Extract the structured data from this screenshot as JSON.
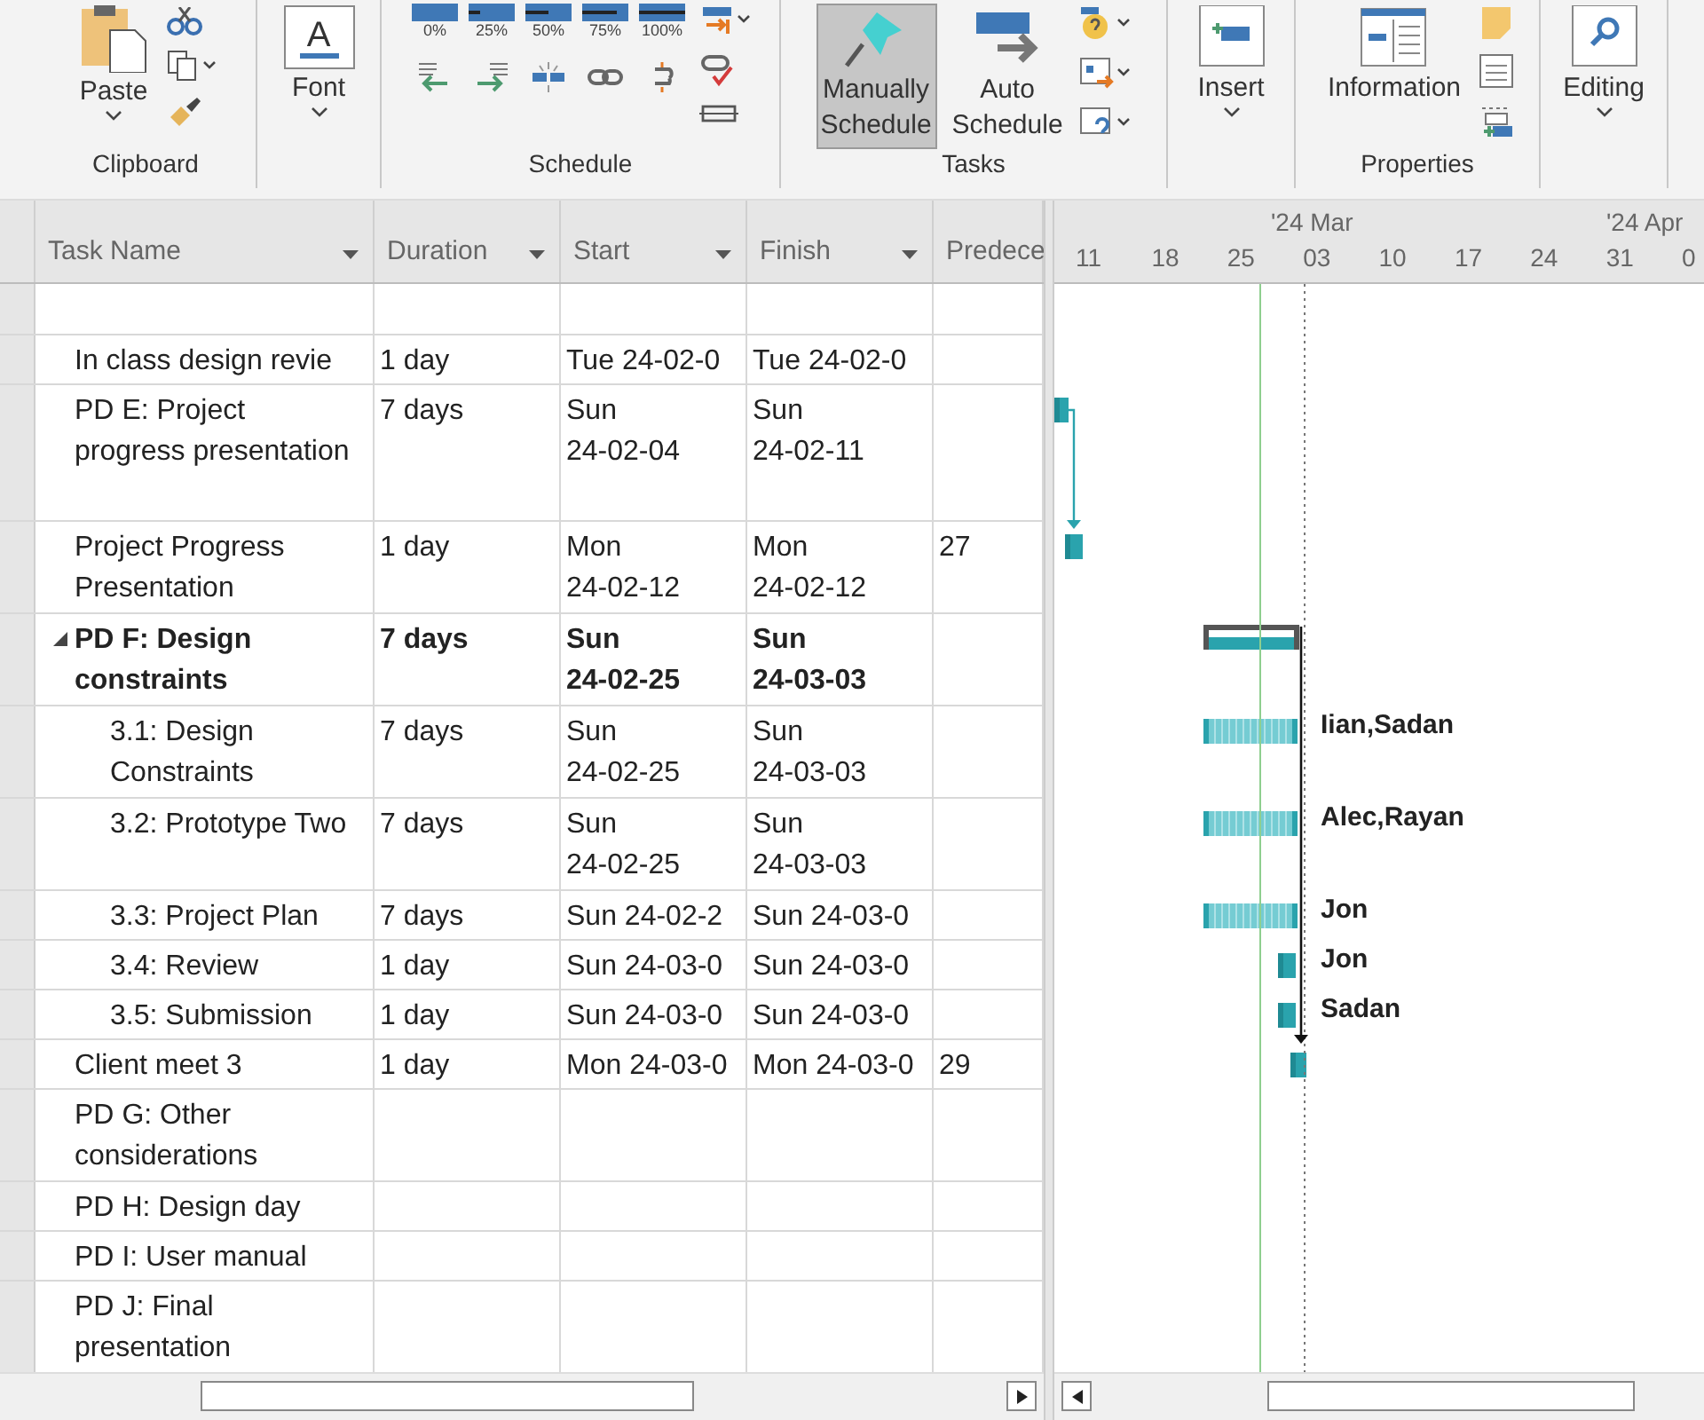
{
  "ribbon": {
    "groups": [
      {
        "label": "Clipboard",
        "buttons": [
          {
            "label": "Paste"
          }
        ]
      },
      {
        "buttons": [
          {
            "label": "Font",
            "icon_text": "A"
          }
        ]
      },
      {
        "label": "Schedule",
        "buttons": [
          {
            "label": "0%"
          },
          {
            "label": "25%"
          },
          {
            "label": "50%"
          },
          {
            "label": "75%"
          },
          {
            "label": "100%"
          }
        ]
      },
      {
        "label": "Tasks",
        "buttons": [
          {
            "label": "Manually Schedule",
            "selected": true
          },
          {
            "label": "Auto Schedule",
            "selected": false
          }
        ]
      },
      {
        "buttons": [
          {
            "label": "Insert"
          }
        ]
      },
      {
        "label": "Properties",
        "buttons": [
          {
            "label": "Information"
          }
        ]
      },
      {
        "buttons": [
          {
            "label": "Editing"
          }
        ]
      }
    ]
  },
  "table": {
    "columns": [
      "Task Name",
      "Duration",
      "Start",
      "Finish",
      "Predece"
    ],
    "rows": [
      {
        "name": "In class design revie",
        "duration": "1 day",
        "start": "Tue 24-02-0",
        "finish": "Tue 24-02-0"
      },
      {
        "name": "PD E: Project progress presentation",
        "duration": "7 days",
        "start": "Sun 24-02-04",
        "finish": "Sun 24-02-11"
      },
      {
        "name": "Project Progress Presentation",
        "duration": "1 day",
        "start": "Mon 24-02-12",
        "finish": "Mon 24-02-12",
        "predecessors": "27"
      },
      {
        "name": "PD F: Design constraints",
        "duration": "7 days",
        "start": "Sun 24-02-25",
        "finish": "Sun 24-03-03",
        "expanded": true,
        "children": [
          {
            "name": "3.1: Design Constraints",
            "duration": "7 days",
            "start": "Sun 24-02-25",
            "finish": "Sun 24-03-03",
            "resources": "Iian,Sadan"
          },
          {
            "name": "3.2: Prototype Two",
            "duration": "7 days",
            "start": "Sun 24-02-25",
            "finish": "Sun 24-03-03",
            "resources": "Alec,Rayan"
          },
          {
            "name": "3.3: Project Plan",
            "duration": "7 days",
            "start": "Sun 24-02-2",
            "finish": "Sun 24-03-0",
            "resources": "Jon"
          },
          {
            "name": "3.4: Review",
            "duration": "1 day",
            "start": "Sun 24-03-0",
            "finish": "Sun 24-03-0",
            "resources": "Jon"
          },
          {
            "name": "3.5: Submission",
            "duration": "1 day",
            "start": "Sun 24-03-0",
            "finish": "Sun 24-03-0",
            "resources": "Sadan"
          }
        ]
      },
      {
        "name": "Client meet 3",
        "duration": "1 day",
        "start": "Mon 24-03-0",
        "finish": "Mon 24-03-0",
        "predecessors": "29"
      },
      {
        "name": "PD G: Other considerations"
      },
      {
        "name": "PD H: Design day"
      },
      {
        "name": "PD I: User manual"
      },
      {
        "name": "PD J: Final presentation"
      }
    ]
  },
  "timescale": {
    "months": [
      "'24 Mar",
      "'24 Apr"
    ],
    "weeks": [
      "11",
      "18",
      "25",
      "03",
      "10",
      "17",
      "24",
      "31",
      "0"
    ]
  }
}
